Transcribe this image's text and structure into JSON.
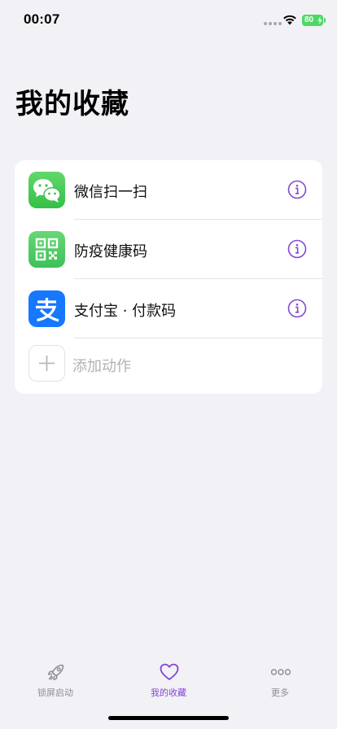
{
  "status_bar": {
    "time": "00:07",
    "battery": "80"
  },
  "title": "我的收藏",
  "favorites": [
    {
      "label": "微信扫一扫",
      "icon": "wechat-icon"
    },
    {
      "label": "防疫健康码",
      "icon": "qr-code-icon"
    },
    {
      "label": "支付宝 · 付款码",
      "icon": "alipay-icon"
    }
  ],
  "add_action_label": "添加动作",
  "tabs": [
    {
      "label": "锁屏启动",
      "icon": "rocket-icon",
      "active": false
    },
    {
      "label": "我的收藏",
      "icon": "heart-icon",
      "active": true
    },
    {
      "label": "更多",
      "icon": "more-icon",
      "active": false
    }
  ],
  "colors": {
    "accent": "#8447d3",
    "background": "#f2f1f6"
  }
}
